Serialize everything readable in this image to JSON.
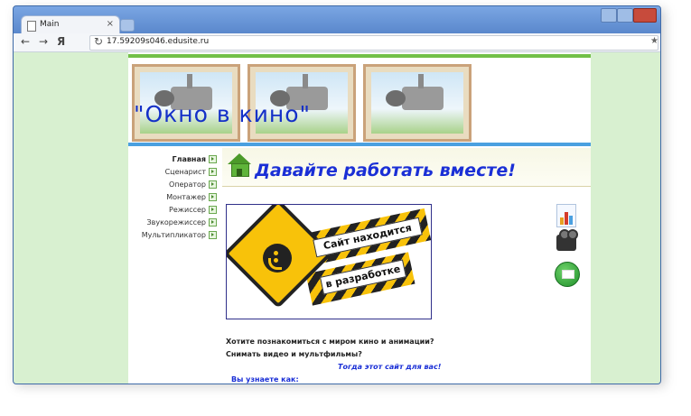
{
  "browser": {
    "tab_title": "Main",
    "tab_close": "×",
    "back": "←",
    "forward": "→",
    "yandex": "Я",
    "reload": "↻",
    "url": "17.59209s046.edusite.ru",
    "star": "★"
  },
  "site": {
    "logo_text": "\"Окно   в   кино\"",
    "headline": "Давайте работать вместе!",
    "menu": [
      {
        "label": "Главная",
        "active": true
      },
      {
        "label": "Сценарист",
        "active": false
      },
      {
        "label": "Оператор",
        "active": false
      },
      {
        "label": "Монтажер",
        "active": false
      },
      {
        "label": "Режиссер",
        "active": false
      },
      {
        "label": "Звукорежиссер",
        "active": false
      },
      {
        "label": "Мультипликатор",
        "active": false
      }
    ],
    "dev_image": {
      "line1": "Сайт находится",
      "line2": "в разработке"
    },
    "side_icons": [
      "chart-icon",
      "film-camera-icon",
      "mail-icon"
    ],
    "paragraphs": {
      "p1": "Хотите познакомиться с миром кино и анимации?",
      "p2": "Снимать видео и мультфильмы?",
      "p3": "Тогда этот сайт для вас!",
      "p4": "Вы узнаете как:"
    },
    "colors": {
      "green_bar": "#72c048",
      "blue_bar": "#4aa0e0",
      "headline": "#1a2fd6",
      "background": "#d8f0d0"
    }
  }
}
